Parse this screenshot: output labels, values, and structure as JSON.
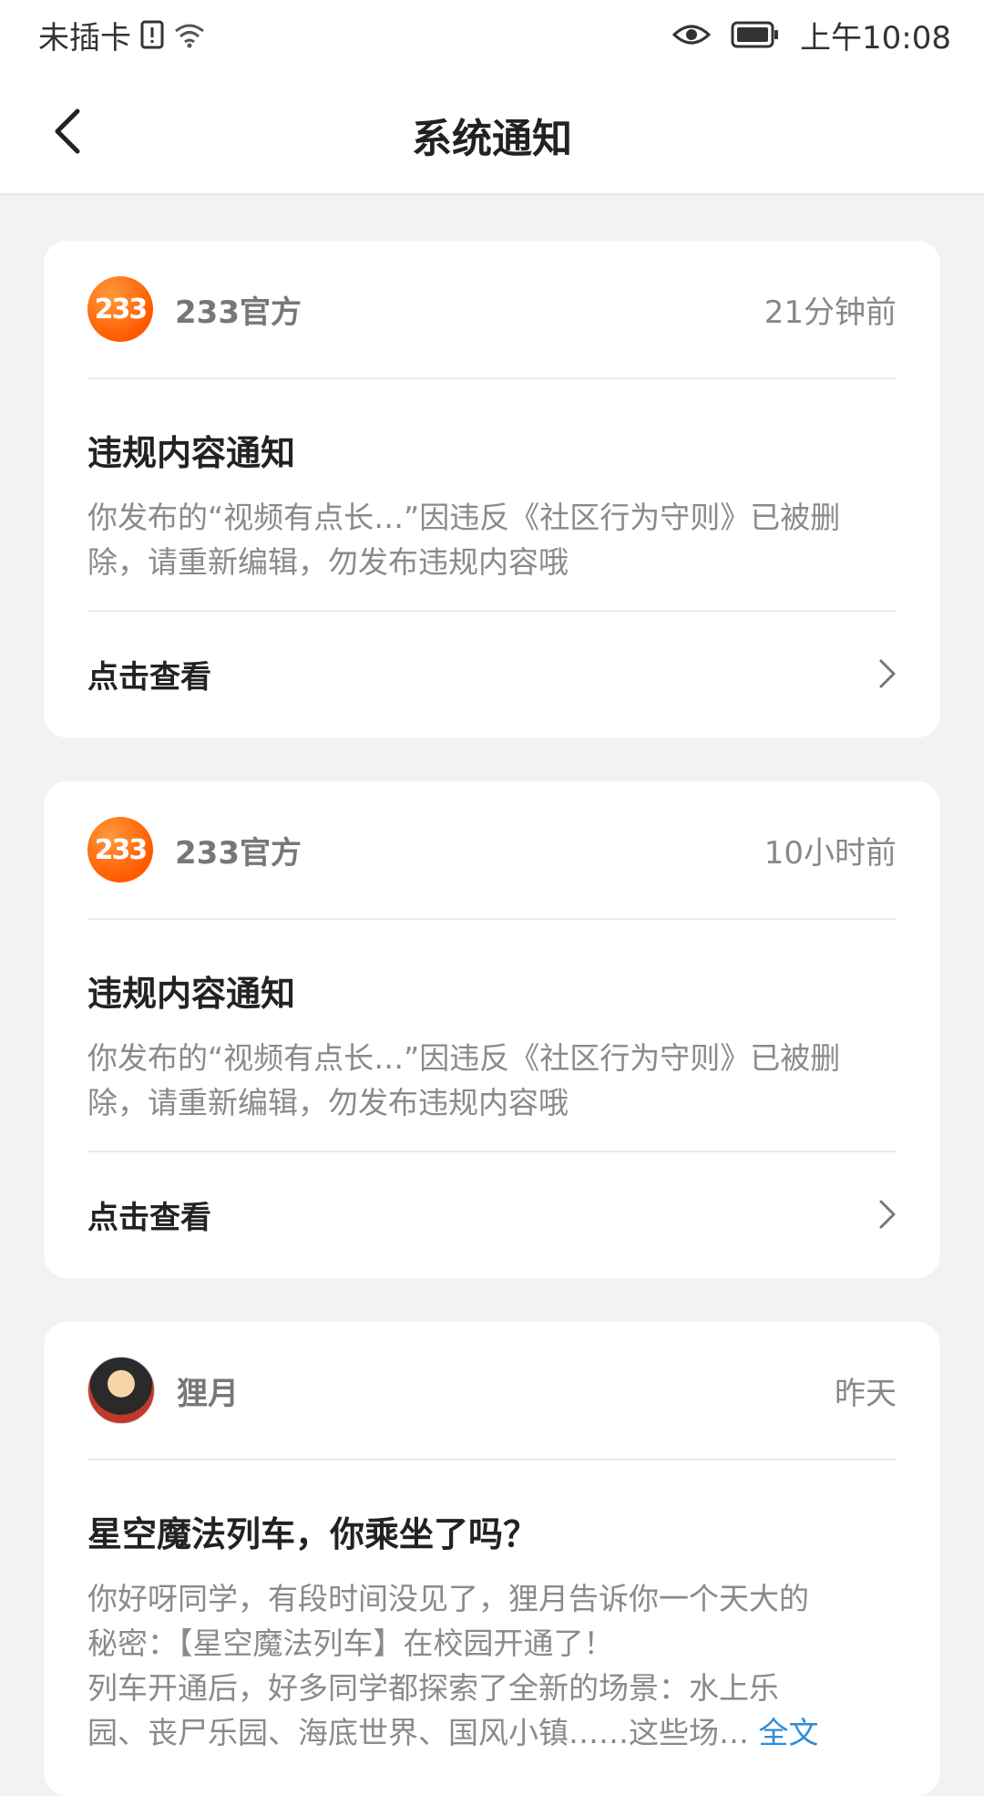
{
  "status_bar": {
    "carrier": "未插卡",
    "time": "上午10:08"
  },
  "header": {
    "title": "系统通知"
  },
  "notifications": [
    {
      "sender": "233官方",
      "logo_text": "233",
      "time": "21分钟前",
      "title": "违规内容通知",
      "body": "你发布的“视频有点长…”因违反《社区行为守则》已被删除，请重新编辑，勿发布违规内容哦",
      "action": "点击查看"
    },
    {
      "sender": "233官方",
      "logo_text": "233",
      "time": "10小时前",
      "title": "违规内容通知",
      "body": "你发布的“视频有点长…”因违反《社区行为守则》已被删除，请重新编辑，勿发布违规内容哦",
      "action": "点击查看"
    },
    {
      "sender": "狸月",
      "time": "昨天",
      "title": "星空魔法列车，你乘坐了吗？",
      "body_line1": "你好呀同学，有段时间没见了，狸月告诉你一个天大的",
      "body_line2": "秘密：【星空魔法列车】在校园开通了！",
      "body_line3": "列车开通后，好多同学都探索了全新的场景：水上乐",
      "body_line4": "园、丧尸乐园、海底世界、国风小镇……这些场…",
      "full_text_link": "全文"
    }
  ],
  "colors": {
    "accent_orange": "#ff6a00",
    "link_blue": "#2f8cd6"
  }
}
